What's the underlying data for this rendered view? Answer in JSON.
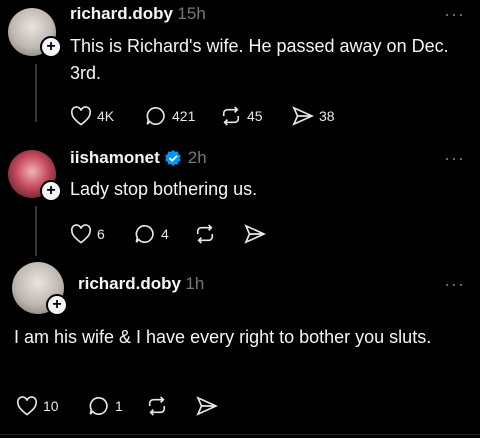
{
  "posts": [
    {
      "username": "richard.doby",
      "time": "15h",
      "text": "This is Richard's wife. He passed away on Dec. 3rd.",
      "likes": "4K",
      "replies": "421",
      "reposts": "45",
      "shares": "38"
    },
    {
      "username": "iishamonet",
      "time": "2h",
      "verified": true,
      "text": "Lady stop bothering us.",
      "likes": "6",
      "replies": "4"
    },
    {
      "username": "richard.doby",
      "time": "1h",
      "text": "I am his wife & I have every right to bother you sluts.",
      "likes": "10",
      "replies": "1"
    }
  ],
  "more_icon": "more-horizontal-icon",
  "colors": {
    "background": "#000000",
    "text": "#f3f5f7",
    "muted": "#777777",
    "verified": "#0095f6"
  }
}
